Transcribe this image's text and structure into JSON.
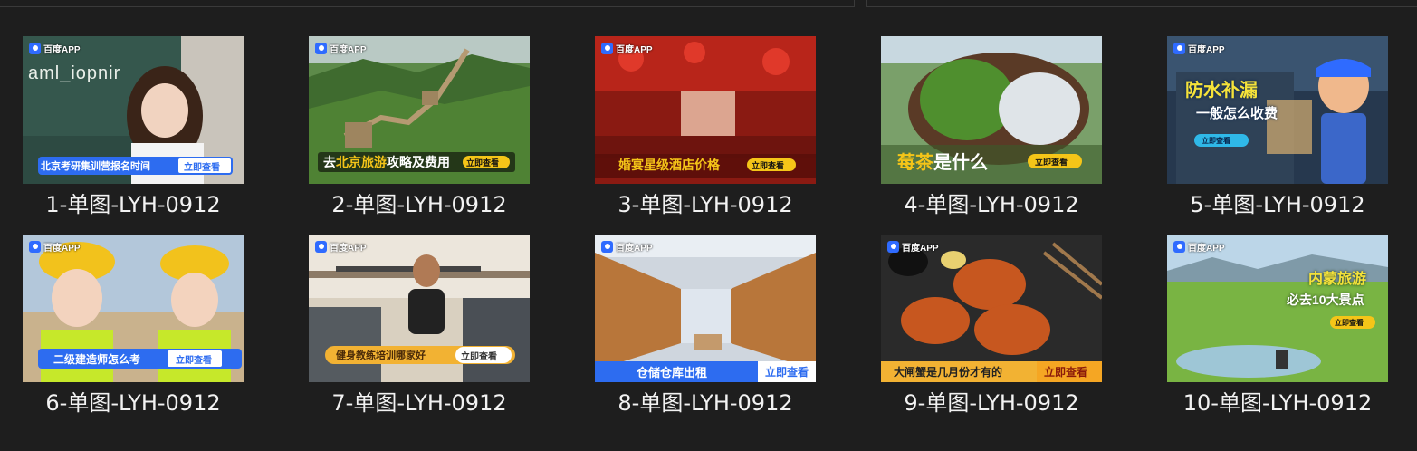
{
  "items": [
    {
      "caption": "1-单图-LYH-0912",
      "logo": "百度APP",
      "banner": "北京考研集训营报名时间",
      "cta": "立即查看",
      "board_text": "aml_iopnir"
    },
    {
      "caption": "2-单图-LYH-0912",
      "logo": "百度APP",
      "banner_pre": "去",
      "banner_hl": "北京旅游",
      "banner_post": "攻略及费用",
      "cta": "立即查看"
    },
    {
      "caption": "3-单图-LYH-0912",
      "logo": "百度APP",
      "banner": "婚宴星级酒店价格",
      "cta": "立即查看"
    },
    {
      "caption": "4-单图-LYH-0912",
      "logo": "",
      "banner_hl": "莓茶",
      "banner_post": "是什么",
      "cta": "立即查看"
    },
    {
      "caption": "5-单图-LYH-0912",
      "logo": "百度APP",
      "title1": "防水补漏",
      "title2": "一般怎么收费",
      "cta": "立即查看"
    },
    {
      "caption": "6-单图-LYH-0912",
      "logo": "百度APP",
      "banner": "二级建造师怎么考",
      "cta": "立即查看"
    },
    {
      "caption": "7-单图-LYH-0912",
      "logo": "百度APP",
      "banner": "健身教练培训哪家好",
      "cta": "立即查看"
    },
    {
      "caption": "8-单图-LYH-0912",
      "logo": "百度APP",
      "banner": "仓储仓库出租",
      "cta": "立即查看"
    },
    {
      "caption": "9-单图-LYH-0912",
      "logo": "百度APP",
      "banner": "大闸蟹是几月份才有的",
      "cta": "立即查看"
    },
    {
      "caption": "10-单图-LYH-0912",
      "logo": "百度APP",
      "title1": "内蒙旅游",
      "title2": "必去10大景点",
      "cta": "立即查看"
    }
  ],
  "colors": {
    "background": "#1e1e1e",
    "caption_text": "#f2f2f2",
    "logo_blue": "#2f6bff",
    "cta_yellow": "#f5c518",
    "banner_blue": "#2d6cf0"
  }
}
